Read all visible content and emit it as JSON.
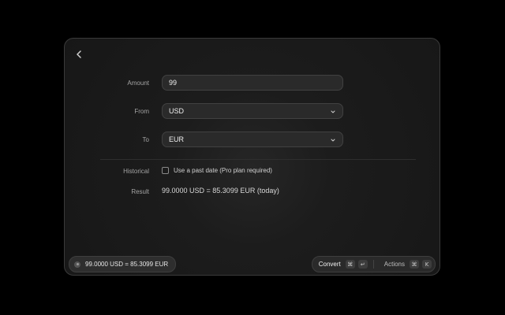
{
  "form": {
    "amount_label": "Amount",
    "amount_value": "99",
    "from_label": "From",
    "from_value": "USD",
    "to_label": "To",
    "to_value": "EUR",
    "historical_label": "Historical",
    "historical_checkbox_label": "Use a past date (Pro plan required)",
    "historical_checked": false,
    "result_label": "Result",
    "result_value": "99.0000 USD = 85.3099 EUR (today)"
  },
  "footer": {
    "status_text": "99.0000 USD = 85.3099 EUR",
    "primary_action_label": "Convert",
    "primary_action_keys": [
      "⌘",
      "↵"
    ],
    "secondary_action_label": "Actions",
    "secondary_action_keys": [
      "⌘",
      "K"
    ]
  },
  "icons": {
    "back": "chevron-left-icon",
    "dropdown": "chevron-down-icon"
  }
}
